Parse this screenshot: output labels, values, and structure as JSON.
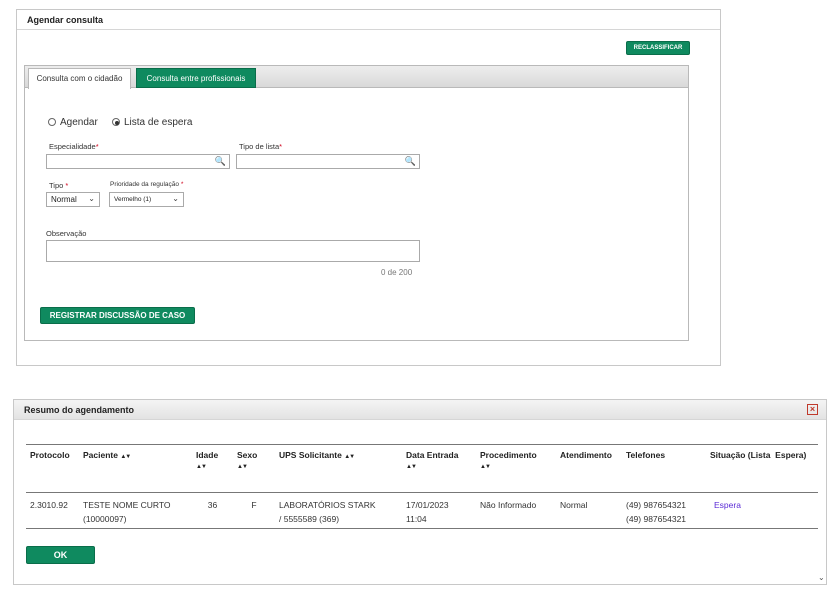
{
  "agendar": {
    "title": "Agendar consulta",
    "reclassificar_label": "RECLASSIFICAR",
    "tabs": [
      {
        "label": "Consulta com o cidadão"
      },
      {
        "label": "Consulta entre profissionais"
      }
    ],
    "radio_agendar": "Agendar",
    "radio_lista": "Lista de espera",
    "especialidade_label": "Especialidade",
    "tipo_lista_label": "Tipo de lista",
    "tipo_label": "Tipo",
    "tipo_value": "Normal",
    "prioridade_label": "Prioridade da regulação",
    "prioridade_value": "Vermelho (1)",
    "observacao_label": "Observação",
    "counter": "0 de 200",
    "registrar_label": "REGISTRAR DISCUSSÃO DE CASO",
    "required_mark": "*"
  },
  "resumo": {
    "title": "Resumo do agendamento",
    "close_icon": "close-icon",
    "columns": {
      "protocolo": "Protocolo",
      "paciente": "Paciente",
      "idade": "Idade",
      "sexo": "Sexo",
      "ups": "UPS Solicitante",
      "data": "Data Entrada",
      "procedimento": "Procedimento",
      "atendimento": "Atendimento",
      "telefones": "Telefones",
      "situacao": "Situação (Lista  Espera)"
    },
    "sort_glyph": "▲▼",
    "row": {
      "protocolo": "2.3010.92",
      "paciente_nome": "TESTE NOME CURTO",
      "paciente_id": "(10000097)",
      "idade": "36",
      "sexo": "F",
      "ups_line1": "LABORATÓRIOS STARK",
      "ups_line2": "/ 5555589 (369)",
      "data_line1": "17/01/2023",
      "data_line2": "11:04",
      "procedimento": "Não Informado",
      "atendimento": "Normal",
      "telefone1": "(49) 987654321",
      "telefone2": "(49) 987654321",
      "situacao": "Espera"
    },
    "ok_label": "OK"
  }
}
